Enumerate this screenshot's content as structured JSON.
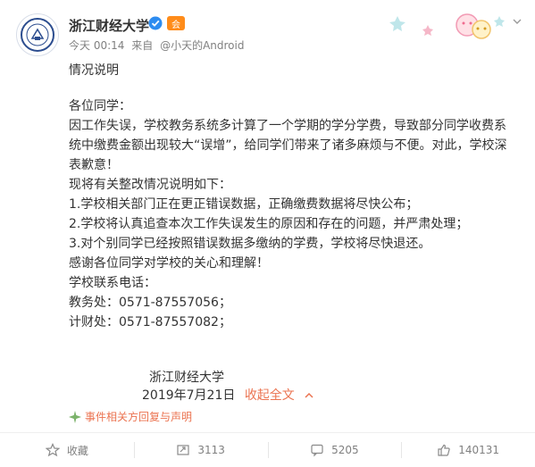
{
  "header": {
    "username": "浙江财经大学",
    "vip_label": "会",
    "time": "今天 00:14",
    "source_prefix": "来自",
    "source": "@小天的Android"
  },
  "post": {
    "title": "情况说明",
    "greeting": "各位同学：",
    "paragraph1": "因工作失误，学校教务系统多计算了一个学期的学分学费，导致部分同学收费系统中缴费金额出现较大“误增”，给同学们带来了诸多麻烦与不便。对此，学校深表歉意！",
    "intro": "现将有关整改情况说明如下：",
    "items": [
      "1.学校相关部门正在更正错误数据，正确缴费数据将尽快公布；",
      "2.学校将认真追查本次工作失误发生的原因和存在的问题，并严肃处理；",
      "3.对个别同学已经按照错误数据多缴纳的学费，学校将尽快退还。"
    ],
    "thanks": "感谢各位同学对学校的关心和理解！",
    "contact_title": "学校联系电话：",
    "contacts": [
      "教务处：0571-87557056；",
      "计财处：0571-87557082；"
    ],
    "signature": "浙江财经大学",
    "date": "2019年7月21日",
    "collapse_label": "收起全文",
    "related_label": "事件相关方回复与声明"
  },
  "actions": {
    "favorite": "收藏",
    "repost_count": "3113",
    "comment_count": "5205",
    "like_count": "140131"
  },
  "colors": {
    "accent": "#eb7350",
    "text": "#333333",
    "muted": "#808080",
    "verified": "#2d8cf0",
    "vip": "#ff8c1a"
  }
}
